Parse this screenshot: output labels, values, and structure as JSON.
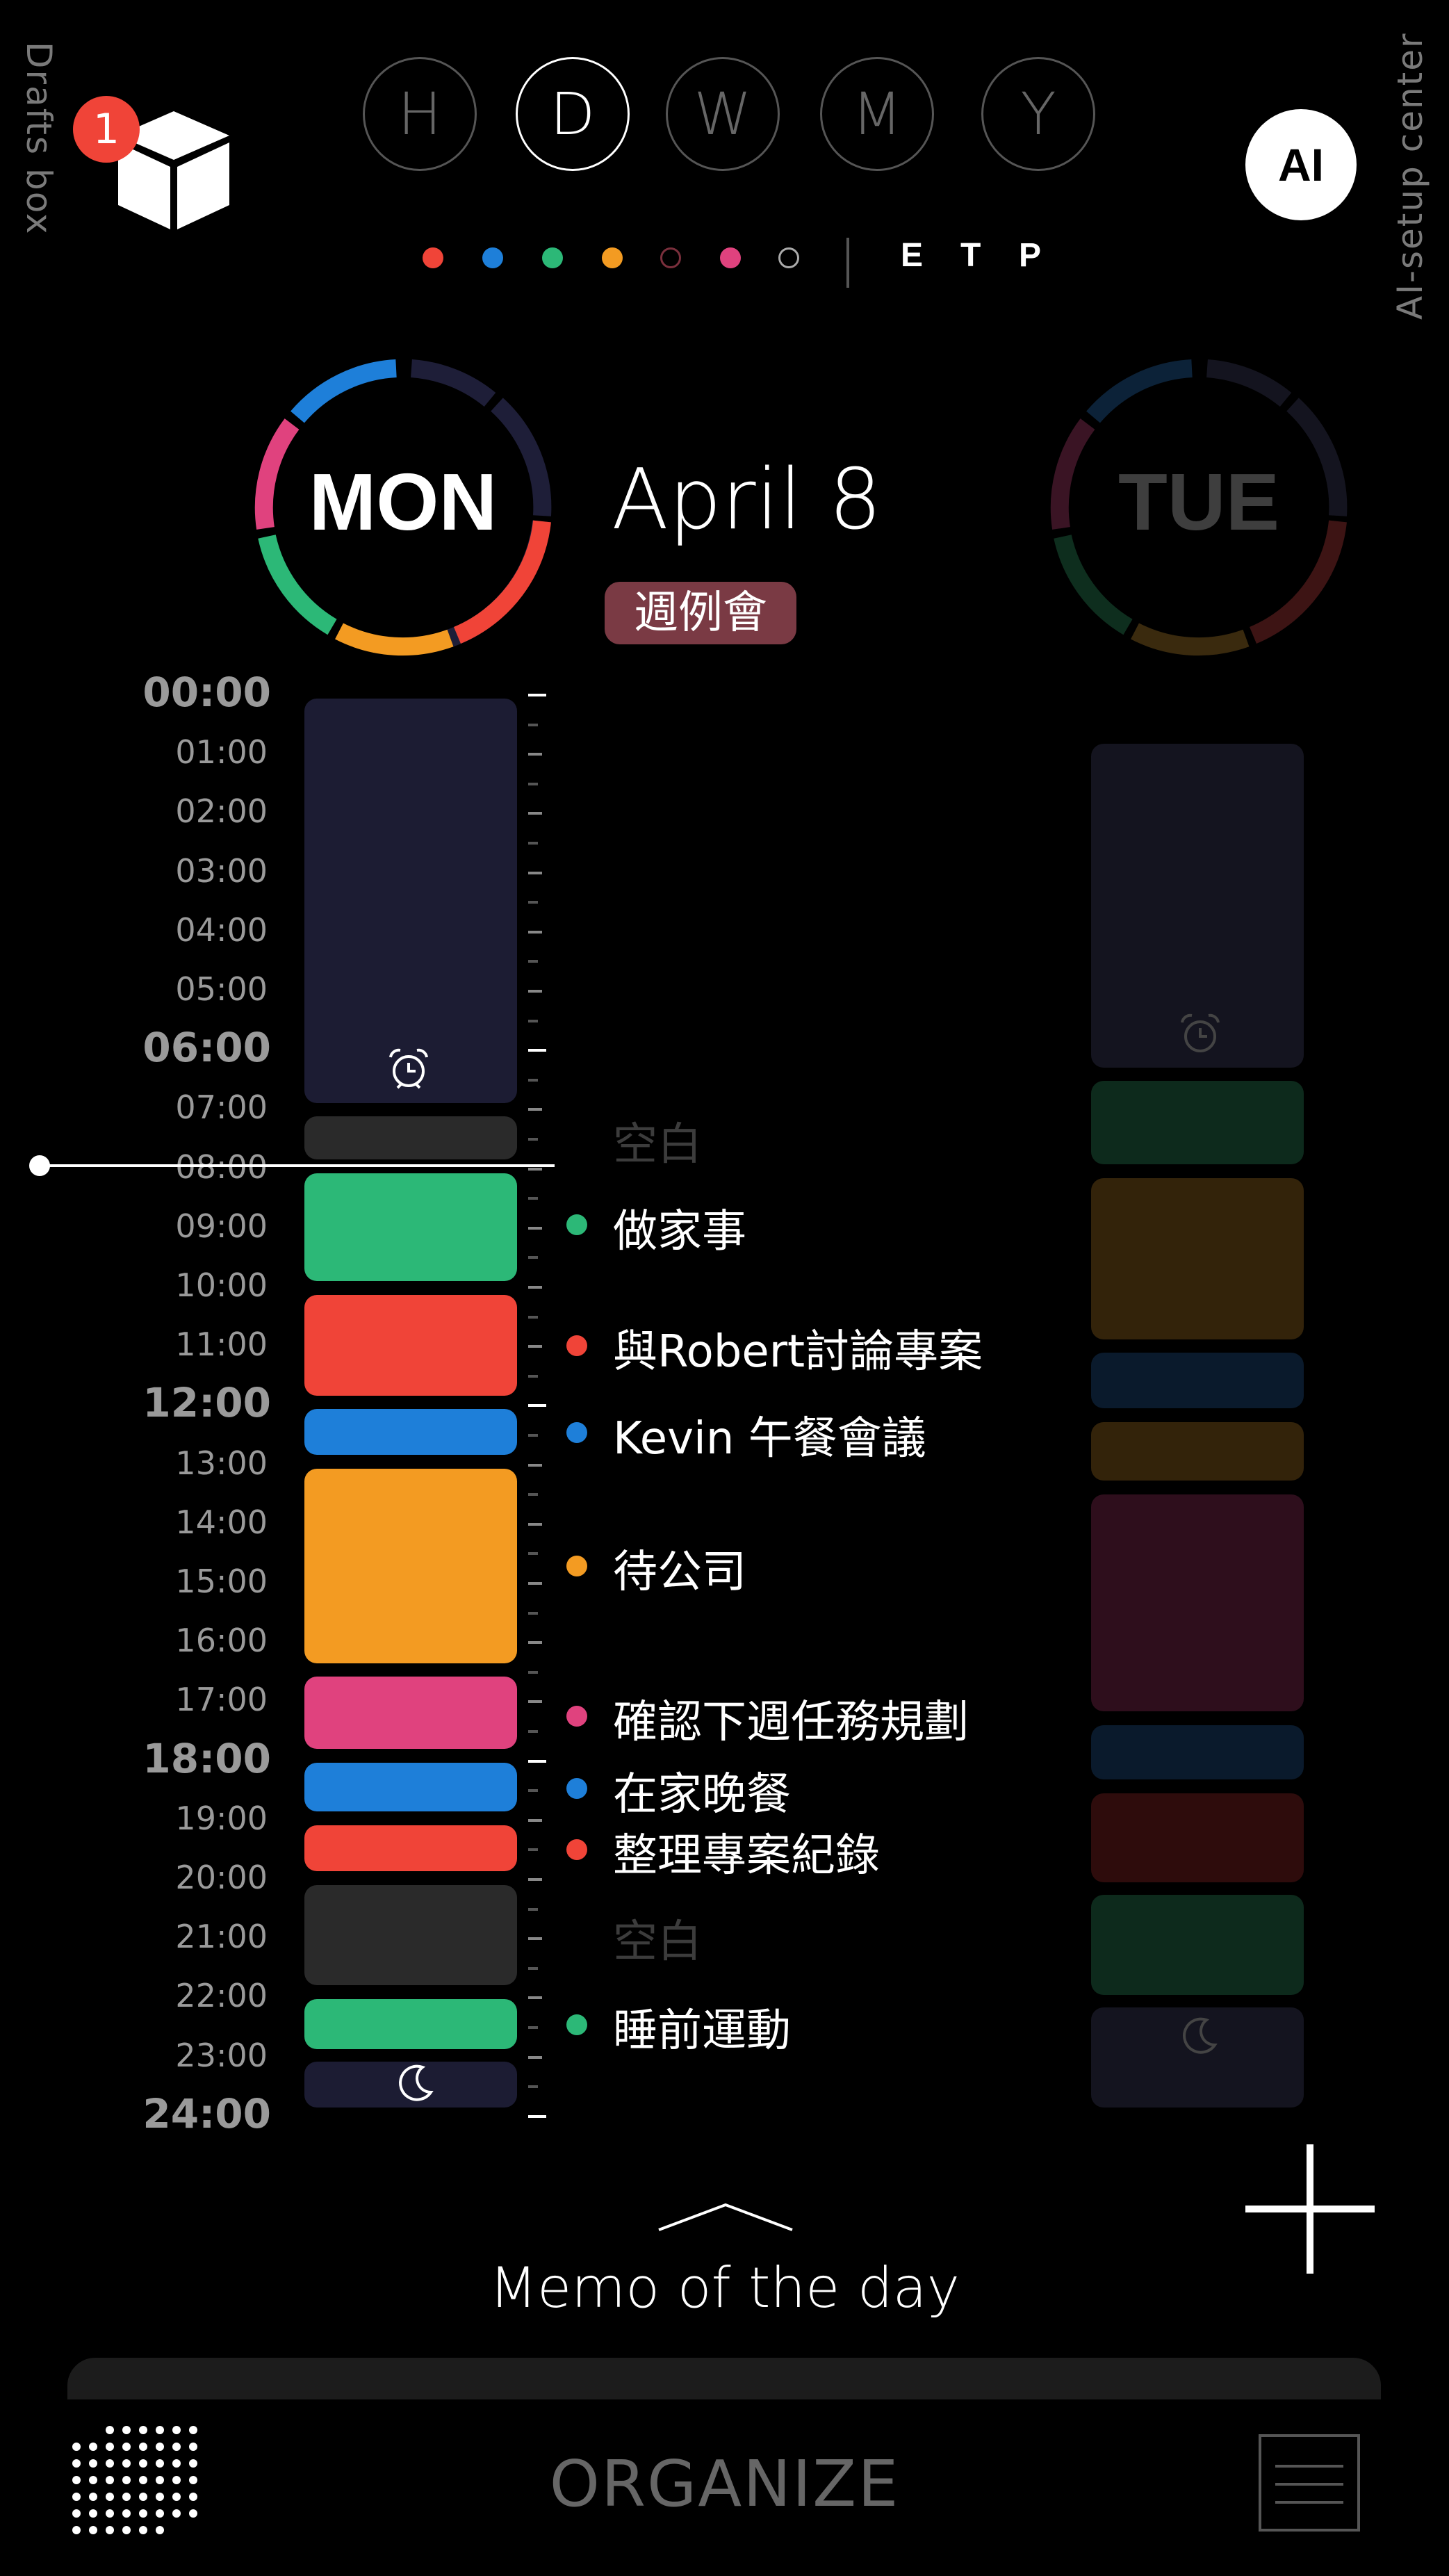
{
  "side": {
    "left_label": "Drafts box",
    "right_label": "AI-setup center",
    "drafts_count": "1"
  },
  "ranges": [
    "H",
    "D",
    "W",
    "M",
    "Y"
  ],
  "active_range": "D",
  "ai_label": "AI",
  "filter_dots": [
    {
      "color": "#f04438",
      "filled": true
    },
    {
      "color": "#1e7fd9",
      "filled": true
    },
    {
      "color": "#2cb877",
      "filled": true
    },
    {
      "color": "#f39b22",
      "filled": true
    },
    {
      "color": "#7a2f3c",
      "filled": false
    },
    {
      "color": "#e0427e",
      "filled": true
    },
    {
      "color": "#aaaaaa",
      "filled": false
    }
  ],
  "etp": [
    "E",
    "T",
    "P"
  ],
  "today": {
    "day": "MON",
    "date": "April 8",
    "badge": "週例會"
  },
  "next_day": {
    "day": "TUE"
  },
  "hours": [
    "00:00",
    "01:00",
    "02:00",
    "03:00",
    "04:00",
    "05:00",
    "06:00",
    "07:00",
    "08:00",
    "09:00",
    "10:00",
    "11:00",
    "12:00",
    "13:00",
    "14:00",
    "15:00",
    "16:00",
    "17:00",
    "18:00",
    "19:00",
    "20:00",
    "21:00",
    "22:00",
    "23:00",
    "24:00"
  ],
  "events": [
    {
      "label": "空白",
      "color": "#3c3c3c",
      "blank": true
    },
    {
      "label": "做家事",
      "color": "#2cb877"
    },
    {
      "label": "與Robert討論專案",
      "color": "#f04438"
    },
    {
      "label": "Kevin 午餐會議",
      "color": "#1e7fd9"
    },
    {
      "label": "待公司",
      "color": "#f39b22"
    },
    {
      "label": "確認下週任務規劃",
      "color": "#e0427e"
    },
    {
      "label": "在家晚餐",
      "color": "#1e7fd9"
    },
    {
      "label": "整理專案紀錄",
      "color": "#f04438"
    },
    {
      "label": "空白",
      "color": "#3c3c3c",
      "blank": true
    },
    {
      "label": "睡前運動",
      "color": "#2cb877"
    }
  ],
  "icons": {
    "alarm": "alarm-clock-icon",
    "moon": "moon-icon",
    "drafts": "box-icon",
    "add": "plus-icon",
    "grid": "dot-grid-icon",
    "menu": "menu-icon",
    "chevron": "chevron-up-icon"
  },
  "memo_label": "Memo of the day",
  "organize_label": "ORGANIZE"
}
